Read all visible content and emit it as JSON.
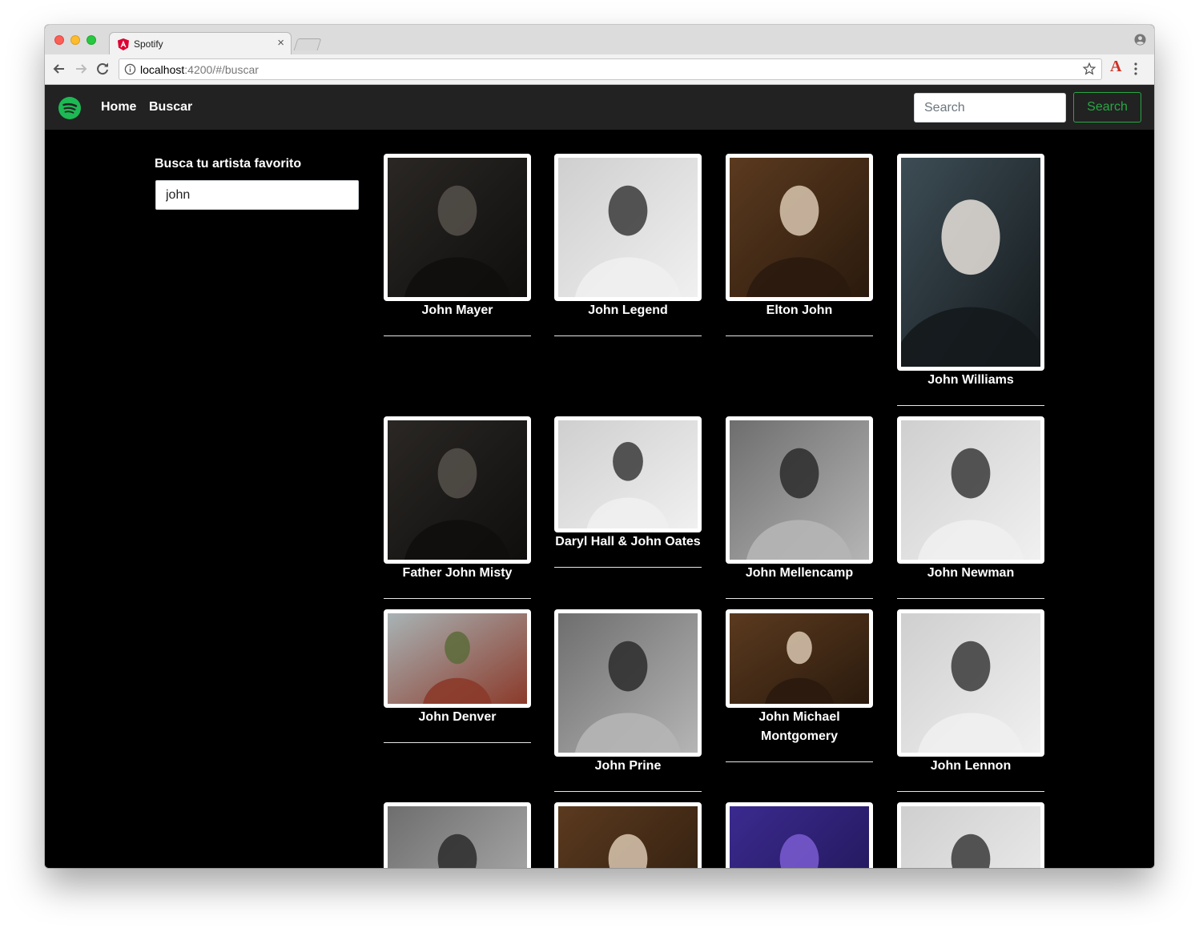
{
  "browser": {
    "tab_title": "Spotify",
    "url_host": "localhost",
    "url_rest": ":4200/#/buscar"
  },
  "navbar": {
    "home_label": "Home",
    "buscar_label": "Buscar",
    "search_placeholder": "Search",
    "search_button": "Search"
  },
  "sidebar": {
    "title": "Busca tu artista favorito",
    "query": "john"
  },
  "colors": {
    "navbar_bg": "#222222",
    "spotify_green": "#1db954",
    "search_button": "#28a745",
    "page_bg": "#000000"
  },
  "artists": [
    {
      "name": "John Mayer",
      "tone": "dark"
    },
    {
      "name": "John Legend",
      "tone": "light"
    },
    {
      "name": "Elton John",
      "tone": "warm"
    },
    {
      "name": "John Williams",
      "tone": "cool"
    },
    {
      "name": "Father John Misty",
      "tone": "dark"
    },
    {
      "name": "Daryl Hall & John Oates",
      "tone": "light"
    },
    {
      "name": "John Mellencamp",
      "tone": "mid"
    },
    {
      "name": "John Newman",
      "tone": "light"
    },
    {
      "name": "John Denver",
      "tone": "nature"
    },
    {
      "name": "John Prine",
      "tone": "mid"
    },
    {
      "name": "John Michael Montgomery",
      "tone": "warm"
    },
    {
      "name": "John Lennon",
      "tone": "light"
    },
    {
      "name": "",
      "tone": "mid"
    },
    {
      "name": "",
      "tone": "warm"
    },
    {
      "name": "",
      "tone": "purple"
    },
    {
      "name": "",
      "tone": "light"
    }
  ]
}
